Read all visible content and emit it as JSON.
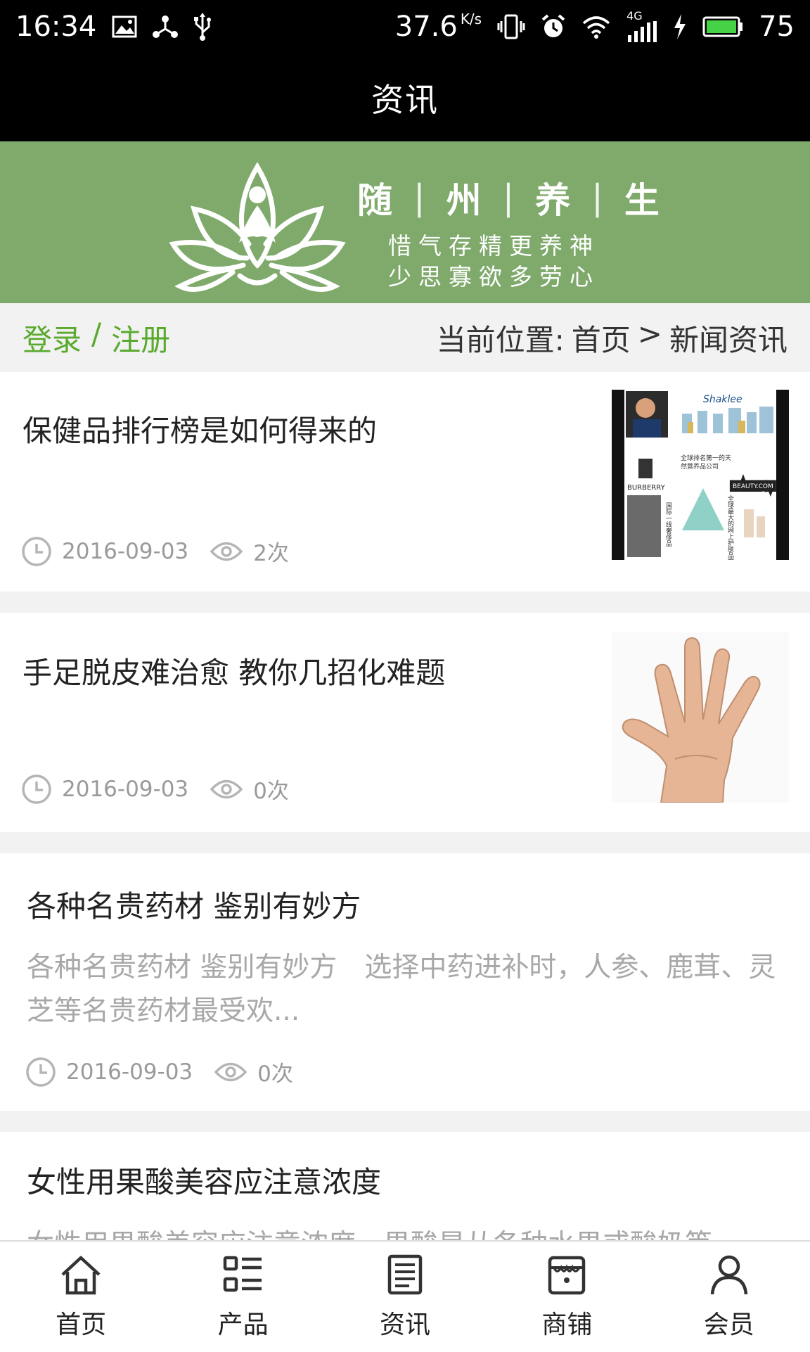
{
  "status_bar": {
    "time": "16:34",
    "speed": "37.6",
    "speed_unit": "K/s",
    "network": "4G",
    "battery": "75",
    "left_icons": [
      "image-icon",
      "share-icon",
      "usb-icon"
    ],
    "right_icons": [
      "vibrate-icon",
      "alarm-icon",
      "wifi-icon",
      "signal-icon",
      "charging-icon",
      "battery-icon"
    ]
  },
  "header": {
    "title": "资讯"
  },
  "banner": {
    "brand_chars": [
      "随",
      "州",
      "养",
      "生"
    ],
    "separator": "|",
    "motto_line1": "惜气存精更养神",
    "motto_line2": "少思寡欲多劳心",
    "bg_color": "#7faa6c"
  },
  "breadcrumb_bar": {
    "login": "登录",
    "slash": "/",
    "register": "注册",
    "location_label": "当前位置:",
    "home": "首页",
    "arrow": ">",
    "current": "新闻资讯",
    "accent_color": "#5aaa2e"
  },
  "news": [
    {
      "title": "保健品排行榜是如何得来的",
      "date": "2016-09-03",
      "views": "2次",
      "thumb_text": {
        "brand": "Shaklee",
        "line1": "全球排名第一的天",
        "line2": "然营养品公司",
        "logo": "BURBERRY",
        "vertical1": "国际一线奢侈品",
        "beauty": "BEAUTY.COM",
        "vertical2": "全球最大的网上护肤品商城"
      }
    },
    {
      "title": "手足脱皮难治愈 教你几招化难题",
      "date": "2016-09-03",
      "views": "0次"
    },
    {
      "title": "各种名贵药材 鉴别有妙方",
      "summary": "各种名贵药材 鉴别有妙方　选择中药进补时，人参、鹿茸、灵芝等名贵药材最受欢...",
      "date": "2016-09-03",
      "views": "0次"
    },
    {
      "title": "女性用果酸美容应注意浓度",
      "summary": "女性用果酸美容应注意浓度　果酸是从各种水果或酸奶等"
    }
  ],
  "bottom_nav": [
    {
      "label": "首页",
      "icon": "home-icon"
    },
    {
      "label": "产品",
      "icon": "product-list-icon"
    },
    {
      "label": "资讯",
      "icon": "news-icon"
    },
    {
      "label": "商铺",
      "icon": "shop-icon"
    },
    {
      "label": "会员",
      "icon": "user-icon"
    }
  ]
}
